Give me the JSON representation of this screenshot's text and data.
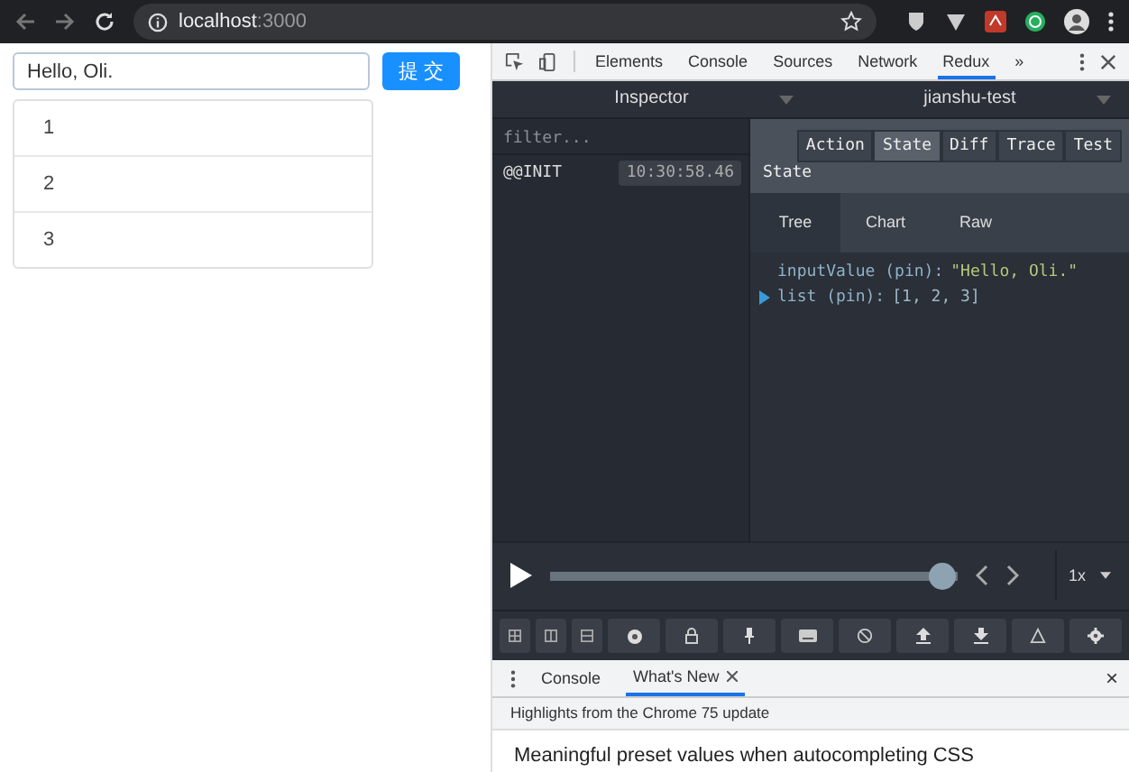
{
  "browser": {
    "host": "localhost",
    "port": ":3000"
  },
  "page": {
    "input": {
      "value": "Hello, Oli."
    },
    "submit": "提 交",
    "items": [
      "1",
      "2",
      "3"
    ]
  },
  "devtools": {
    "tabs": [
      {
        "label": "Elements",
        "selected": false
      },
      {
        "label": "Console",
        "selected": false
      },
      {
        "label": "Sources",
        "selected": false
      },
      {
        "label": "Network",
        "selected": false
      },
      {
        "label": "Redux",
        "selected": true
      }
    ],
    "more": "»",
    "monitor": "Inspector",
    "instance": "jianshu-test",
    "filter": {
      "placeholder": "filter..."
    },
    "actions": [
      {
        "name": "@@INIT",
        "time": "10:30:58.46"
      }
    ],
    "detail_tabs": [
      {
        "label": "Action",
        "selected": false
      },
      {
        "label": "State",
        "selected": true
      },
      {
        "label": "Diff",
        "selected": false
      },
      {
        "label": "Trace",
        "selected": false
      },
      {
        "label": "Test",
        "selected": false
      }
    ],
    "heading": "State",
    "view_tabs": [
      {
        "label": "Tree",
        "selected": true
      },
      {
        "label": "Chart",
        "selected": false
      },
      {
        "label": "Raw",
        "selected": false
      }
    ],
    "tree": [
      {
        "key": "inputValue",
        "tag": "(pin):",
        "value": "\"Hello, Oli.\"",
        "expandable": false
      },
      {
        "key": "list",
        "tag": "(pin):",
        "value": "[1, 2, 3]",
        "expandable": true
      }
    ],
    "slider": {
      "level": 1
    },
    "speed": "1x"
  },
  "drawer": {
    "tabs": [
      {
        "label": "Console",
        "selected": false,
        "closable": false
      },
      {
        "label": "What's New",
        "selected": true,
        "closable": true
      }
    ],
    "close": "×",
    "highlights": "Highlights from the Chrome 75 update",
    "feature": "Meaningful preset values when autocompleting CSS"
  }
}
